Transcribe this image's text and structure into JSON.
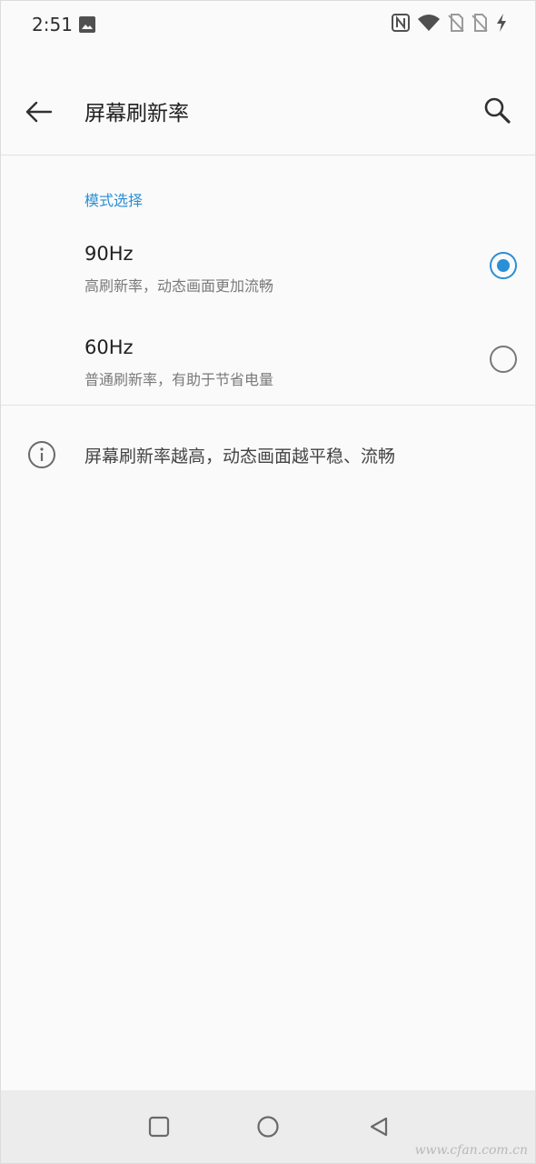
{
  "status_bar": {
    "time": "2:51",
    "icons": [
      "photo-icon",
      "nfc-icon",
      "wifi-icon",
      "no-sim-icon",
      "no-sim-2-icon",
      "charging-icon"
    ]
  },
  "app_bar": {
    "title": "屏幕刷新率",
    "back_icon": "back-arrow-icon",
    "search_icon": "search-icon"
  },
  "section": {
    "header": "模式选择",
    "options": [
      {
        "title": "90Hz",
        "subtitle": "高刷新率，动态画面更加流畅",
        "selected": true
      },
      {
        "title": "60Hz",
        "subtitle": "普通刷新率，有助于节省电量",
        "selected": false
      }
    ]
  },
  "info": {
    "icon": "info-icon",
    "text": "屏幕刷新率越高，动态画面越平稳、流畅"
  },
  "nav_bar": {
    "buttons": [
      "recents-icon",
      "home-icon",
      "back-icon"
    ],
    "watermark": "www.cfan.com.cn"
  },
  "colors": {
    "accent": "#2a8fd4",
    "background": "#fafafa",
    "nav_background": "#ececec"
  }
}
